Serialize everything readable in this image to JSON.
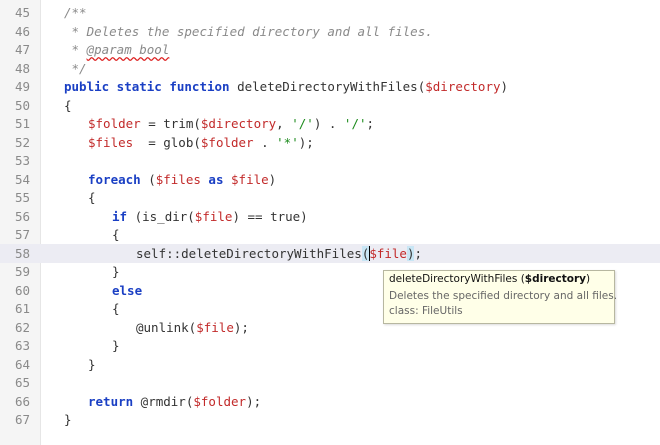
{
  "editor": {
    "lines": [
      {
        "num": "45",
        "indent": 1,
        "tokens": [
          {
            "t": "/**",
            "c": "cm"
          }
        ]
      },
      {
        "num": "46",
        "indent": 1,
        "tokens": [
          {
            "t": " * Deletes the specified directory and all files.",
            "c": "cm"
          }
        ]
      },
      {
        "num": "47",
        "indent": 1,
        "tokens": [
          {
            "t": " * ",
            "c": "cm"
          },
          {
            "t": "@param bool",
            "c": "cm-tag"
          }
        ]
      },
      {
        "num": "48",
        "indent": 1,
        "tokens": [
          {
            "t": " */",
            "c": "cm"
          }
        ]
      },
      {
        "num": "49",
        "indent": 1,
        "tokens": [
          {
            "t": "public static function ",
            "c": "kw"
          },
          {
            "t": "deleteDirectoryWithFiles(",
            "c": "fn"
          },
          {
            "t": "$directory",
            "c": "var"
          },
          {
            "t": ")",
            "c": "fn"
          }
        ]
      },
      {
        "num": "50",
        "indent": 1,
        "tokens": [
          {
            "t": "{",
            "c": "fn"
          }
        ]
      },
      {
        "num": "51",
        "indent": 2,
        "tokens": [
          {
            "t": "$folder",
            "c": "var"
          },
          {
            "t": " = trim(",
            "c": "fn"
          },
          {
            "t": "$directory",
            "c": "var"
          },
          {
            "t": ", ",
            "c": "fn"
          },
          {
            "t": "'/'",
            "c": "str"
          },
          {
            "t": ") . ",
            "c": "fn"
          },
          {
            "t": "'/'",
            "c": "str"
          },
          {
            "t": ";",
            "c": "fn"
          }
        ]
      },
      {
        "num": "52",
        "indent": 2,
        "tokens": [
          {
            "t": "$files",
            "c": "var"
          },
          {
            "t": "  = glob(",
            "c": "fn"
          },
          {
            "t": "$folder",
            "c": "var"
          },
          {
            "t": " . ",
            "c": "fn"
          },
          {
            "t": "'*'",
            "c": "str"
          },
          {
            "t": ");",
            "c": "fn"
          }
        ]
      },
      {
        "num": "53",
        "indent": 2,
        "tokens": []
      },
      {
        "num": "54",
        "indent": 2,
        "tokens": [
          {
            "t": "foreach",
            "c": "kw"
          },
          {
            "t": " (",
            "c": "fn"
          },
          {
            "t": "$files",
            "c": "var"
          },
          {
            "t": " as ",
            "c": "kw"
          },
          {
            "t": "$file",
            "c": "var"
          },
          {
            "t": ")",
            "c": "fn"
          }
        ]
      },
      {
        "num": "55",
        "indent": 2,
        "tokens": [
          {
            "t": "{",
            "c": "fn"
          }
        ]
      },
      {
        "num": "56",
        "indent": 3,
        "tokens": [
          {
            "t": "if",
            "c": "kw"
          },
          {
            "t": " (is_dir(",
            "c": "fn"
          },
          {
            "t": "$file",
            "c": "var"
          },
          {
            "t": ") == true)",
            "c": "fn"
          }
        ]
      },
      {
        "num": "57",
        "indent": 3,
        "tokens": [
          {
            "t": "{",
            "c": "fn"
          }
        ]
      },
      {
        "num": "58",
        "indent": 4,
        "current": true,
        "tokens": [
          {
            "t": "self::deleteDirectoryWithFiles",
            "c": "fn"
          },
          {
            "t": "(",
            "c": "fn paren-hl"
          },
          {
            "t": "CARET",
            "c": "caret"
          },
          {
            "t": "$file",
            "c": "var"
          },
          {
            "t": ")",
            "c": "fn paren-hl"
          },
          {
            "t": ";",
            "c": "fn"
          }
        ]
      },
      {
        "num": "59",
        "indent": 3,
        "tokens": [
          {
            "t": "}",
            "c": "fn"
          }
        ]
      },
      {
        "num": "60",
        "indent": 3,
        "tokens": [
          {
            "t": "else",
            "c": "kw"
          }
        ]
      },
      {
        "num": "61",
        "indent": 3,
        "tokens": [
          {
            "t": "{",
            "c": "fn"
          }
        ]
      },
      {
        "num": "62",
        "indent": 4,
        "tokens": [
          {
            "t": "@unlink(",
            "c": "fn"
          },
          {
            "t": "$file",
            "c": "var"
          },
          {
            "t": ");",
            "c": "fn"
          }
        ]
      },
      {
        "num": "63",
        "indent": 3,
        "tokens": [
          {
            "t": "}",
            "c": "fn"
          }
        ]
      },
      {
        "num": "64",
        "indent": 2,
        "tokens": [
          {
            "t": "}",
            "c": "fn"
          }
        ]
      },
      {
        "num": "65",
        "indent": 2,
        "tokens": []
      },
      {
        "num": "66",
        "indent": 2,
        "tokens": [
          {
            "t": "return",
            "c": "kw"
          },
          {
            "t": " @rmdir(",
            "c": "fn"
          },
          {
            "t": "$folder",
            "c": "var"
          },
          {
            "t": ");",
            "c": "fn"
          }
        ]
      },
      {
        "num": "67",
        "indent": 1,
        "tokens": [
          {
            "t": "}",
            "c": "fn"
          }
        ]
      }
    ]
  },
  "tooltip": {
    "signature_prefix": "deleteDirectoryWithFiles (",
    "signature_param": "$directory",
    "signature_suffix": ")",
    "description": "Deletes the specified directory and all files.",
    "class_label": "class: FileUtils"
  },
  "colors": {
    "keyword": "#1a3fc4",
    "variable": "#c22a2a",
    "string": "#1b8a1b",
    "comment": "#8a8a8a",
    "current_line": "#ececf3",
    "tooltip_bg": "#ffffe8"
  }
}
